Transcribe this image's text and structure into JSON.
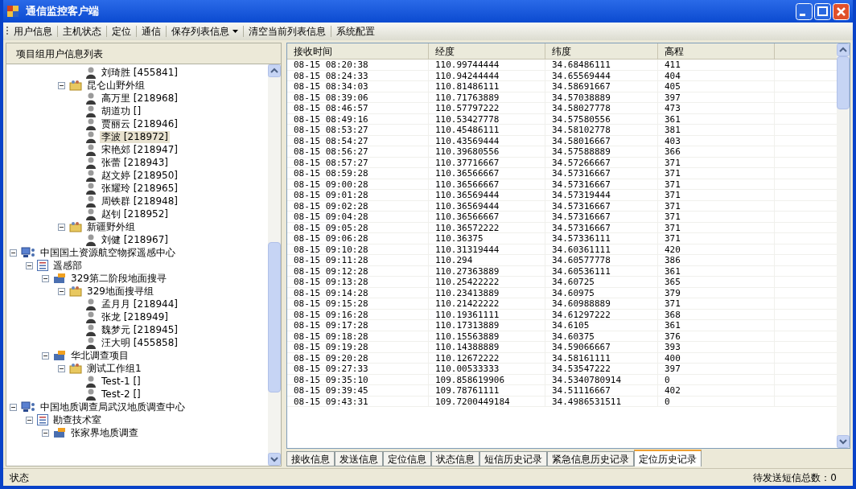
{
  "window": {
    "title": "通信监控客户端"
  },
  "toolbar": [
    {
      "label": "用户信息",
      "dropdown": false
    },
    {
      "label": "主机状态",
      "dropdown": false
    },
    {
      "label": "定位",
      "dropdown": false
    },
    {
      "label": "通信",
      "dropdown": false
    },
    {
      "label": "保存列表信息",
      "dropdown": true
    },
    {
      "label": "清空当前列表信息",
      "dropdown": false
    },
    {
      "label": "系统配置",
      "dropdown": false
    }
  ],
  "tree": {
    "title": "项目组用户信息列表",
    "items": [
      {
        "kind": "hidden",
        "children": [
          {
            "kind": "hidden",
            "children": [
              {
                "kind": "hidden",
                "children": [
                  {
                    "kind": "hidden",
                    "children": [
                      {
                        "kind": "user",
                        "label": "刘琦胜 [455841]",
                        "selected": false
                      }
                    ]
                  },
                  {
                    "kind": "group",
                    "label": "昆仑山野外组",
                    "expanded": true,
                    "selected": false,
                    "children": [
                      {
                        "kind": "user",
                        "label": "高万里 [218968]",
                        "selected": false
                      },
                      {
                        "kind": "user",
                        "label": "胡道功 []",
                        "selected": false
                      },
                      {
                        "kind": "user",
                        "label": "贾丽云 [218946]",
                        "selected": false
                      },
                      {
                        "kind": "user",
                        "label": "李波 [218972]",
                        "selected": true
                      },
                      {
                        "kind": "user",
                        "label": "宋艳郊 [218947]",
                        "selected": false
                      },
                      {
                        "kind": "user",
                        "label": "张蕾 [218943]",
                        "selected": false
                      },
                      {
                        "kind": "user",
                        "label": "赵文婷 [218950]",
                        "selected": false
                      },
                      {
                        "kind": "user",
                        "label": "张耀玲 [218965]",
                        "selected": false
                      },
                      {
                        "kind": "user",
                        "label": "周铁群 [218948]",
                        "selected": false
                      },
                      {
                        "kind": "user",
                        "label": "赵钊 [218952]",
                        "selected": false
                      }
                    ]
                  },
                  {
                    "kind": "group",
                    "label": "新疆野外组",
                    "expanded": true,
                    "selected": false,
                    "children": [
                      {
                        "kind": "user",
                        "label": "刘健 [218967]",
                        "selected": false
                      }
                    ]
                  }
                ]
              }
            ]
          }
        ]
      },
      {
        "kind": "org",
        "label": "中国国土资源航空物探遥感中心",
        "expanded": true,
        "selected": false,
        "children": [
          {
            "kind": "dept",
            "label": "遥感部",
            "expanded": true,
            "selected": false,
            "children": [
              {
                "kind": "project",
                "label": "329第二阶段地面搜寻",
                "expanded": true,
                "selected": false,
                "children": [
                  {
                    "kind": "group",
                    "label": "329地面搜寻组",
                    "expanded": true,
                    "selected": false,
                    "children": [
                      {
                        "kind": "user",
                        "label": "孟月月 [218944]",
                        "selected": false
                      },
                      {
                        "kind": "user",
                        "label": "张龙 [218949]",
                        "selected": false
                      },
                      {
                        "kind": "user",
                        "label": "魏梦元 [218945]",
                        "selected": false
                      },
                      {
                        "kind": "user",
                        "label": "汪大明 [455858]",
                        "selected": false
                      }
                    ]
                  }
                ]
              },
              {
                "kind": "project",
                "label": "华北调查项目",
                "expanded": true,
                "selected": false,
                "children": [
                  {
                    "kind": "group",
                    "label": "测试工作组1",
                    "expanded": true,
                    "selected": false,
                    "children": [
                      {
                        "kind": "user",
                        "label": "Test-1 []",
                        "selected": false
                      },
                      {
                        "kind": "user",
                        "label": "Test-2 []",
                        "selected": false
                      }
                    ]
                  }
                ]
              }
            ]
          }
        ]
      },
      {
        "kind": "org",
        "label": "中国地质调查局武汉地质调查中心",
        "expanded": true,
        "selected": false,
        "children": [
          {
            "kind": "dept",
            "label": "勘查技术室",
            "expanded": true,
            "selected": false,
            "children": [
              {
                "kind": "project",
                "label": "张家界地质调查",
                "expanded": true,
                "selected": false
              }
            ]
          }
        ]
      }
    ]
  },
  "table": {
    "columns": [
      "接收时间",
      "经度",
      "纬度",
      "高程"
    ],
    "rows": [
      [
        "08-15 08:20:38",
        "110.99744444",
        "34.68486111",
        "411"
      ],
      [
        "08-15 08:24:33",
        "110.94244444",
        "34.65569444",
        "404"
      ],
      [
        "08-15 08:34:03",
        "110.81486111",
        "34.58691667",
        "405"
      ],
      [
        "08-15 08:39:06",
        "110.71763889",
        "34.57038889",
        "397"
      ],
      [
        "08-15 08:46:57",
        "110.57797222",
        "34.58027778",
        "473"
      ],
      [
        "08-15 08:49:16",
        "110.53427778",
        "34.57580556",
        "361"
      ],
      [
        "08-15 08:53:27",
        "110.45486111",
        "34.58102778",
        "381"
      ],
      [
        "08-15 08:54:27",
        "110.43569444",
        "34.58016667",
        "403"
      ],
      [
        "08-15 08:56:27",
        "110.39680556",
        "34.57588889",
        "366"
      ],
      [
        "08-15 08:57:27",
        "110.37716667",
        "34.57266667",
        "371"
      ],
      [
        "08-15 08:59:28",
        "110.36566667",
        "34.57316667",
        "371"
      ],
      [
        "08-15 09:00:28",
        "110.36566667",
        "34.57316667",
        "371"
      ],
      [
        "08-15 09:01:28",
        "110.36569444",
        "34.57319444",
        "371"
      ],
      [
        "08-15 09:02:28",
        "110.36569444",
        "34.57316667",
        "371"
      ],
      [
        "08-15 09:04:28",
        "110.36566667",
        "34.57316667",
        "371"
      ],
      [
        "08-15 09:05:28",
        "110.36572222",
        "34.57316667",
        "371"
      ],
      [
        "08-15 09:06:28",
        "110.36375",
        "34.57336111",
        "371"
      ],
      [
        "08-15 09:10:28",
        "110.31319444",
        "34.60361111",
        "420"
      ],
      [
        "08-15 09:11:28",
        "110.294",
        "34.60577778",
        "386"
      ],
      [
        "08-15 09:12:28",
        "110.27363889",
        "34.60536111",
        "361"
      ],
      [
        "08-15 09:13:28",
        "110.25422222",
        "34.60725",
        "365"
      ],
      [
        "08-15 09:14:28",
        "110.23413889",
        "34.60975",
        "379"
      ],
      [
        "08-15 09:15:28",
        "110.21422222",
        "34.60988889",
        "371"
      ],
      [
        "08-15 09:16:28",
        "110.19361111",
        "34.61297222",
        "368"
      ],
      [
        "08-15 09:17:28",
        "110.17313889",
        "34.6105",
        "361"
      ],
      [
        "08-15 09:18:28",
        "110.15563889",
        "34.60375",
        "376"
      ],
      [
        "08-15 09:19:28",
        "110.14388889",
        "34.59066667",
        "393"
      ],
      [
        "08-15 09:20:28",
        "110.12672222",
        "34.58161111",
        "400"
      ],
      [
        "08-15 09:27:33",
        "110.00533333",
        "34.53547222",
        "397"
      ],
      [
        "08-15 09:35:10",
        "109.858619906",
        "34.5340780914",
        "0"
      ],
      [
        "08-15 09:39:45",
        "109.78761111",
        "34.51116667",
        "402"
      ],
      [
        "08-15 09:43:31",
        "109.7200449184",
        "34.4986531511",
        "0"
      ]
    ]
  },
  "tabs": [
    {
      "label": "接收信息",
      "selected": false
    },
    {
      "label": "发送信息",
      "selected": false
    },
    {
      "label": "定位信息",
      "selected": false
    },
    {
      "label": "状态信息",
      "selected": false
    },
    {
      "label": "短信历史记录",
      "selected": false
    },
    {
      "label": "紧急信息历史记录",
      "selected": false
    },
    {
      "label": "定位历史记录",
      "selected": true
    }
  ],
  "status_bar": {
    "left": "状态",
    "right": "待发送短信总数：0"
  }
}
